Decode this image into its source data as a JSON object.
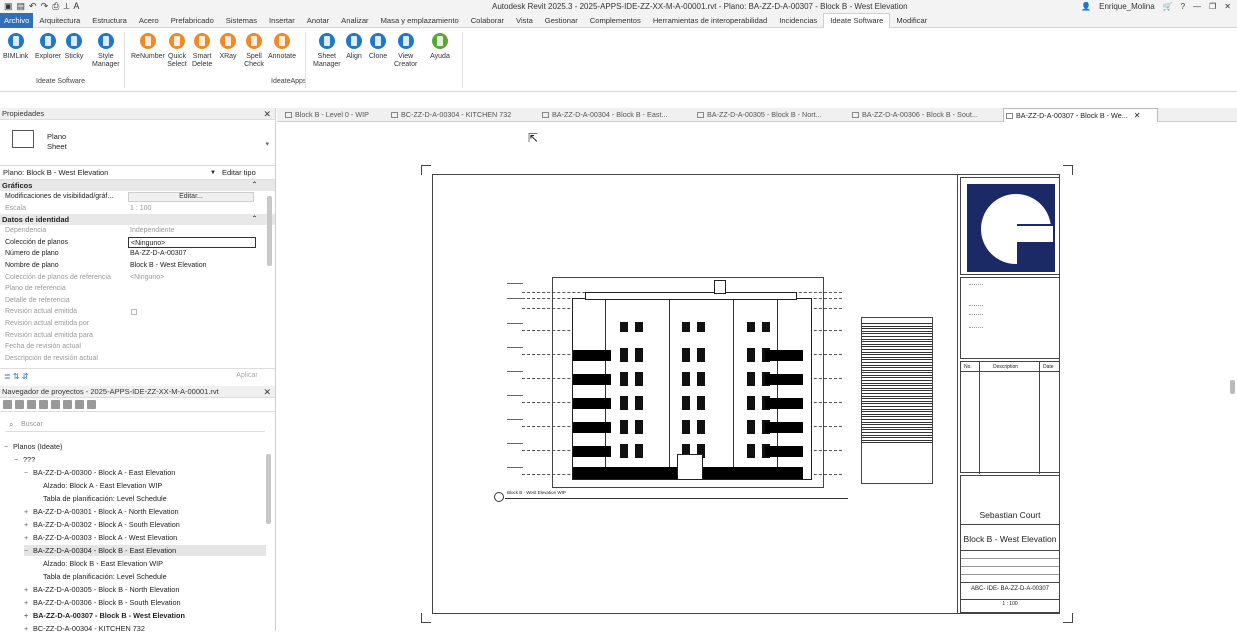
{
  "titlebar": {
    "title": "Autodesk Revit 2025.3 - 2025-APPS-IDE-ZZ-XX-M-A-00001.rvt - Plano: BA-ZZ-D-A-00307 - Block B - West Elevation",
    "user": "Enrique_Molina",
    "help": "?"
  },
  "menu": {
    "tabs": [
      "Archivo",
      "Arquitectura",
      "Estructura",
      "Acero",
      "Prefabricado",
      "Sistemas",
      "Insertar",
      "Anotar",
      "Analizar",
      "Masa y emplazamiento",
      "Colaborar",
      "Vista",
      "Gestionar",
      "Complementos",
      "Herramientas de interoperabilidad",
      "Incidencias",
      "Ideate Software",
      "Modificar"
    ]
  },
  "ribbon": {
    "buttons": [
      {
        "label": "BIMLink",
        "color": "#1f78c8"
      },
      {
        "label": "Explorer",
        "color": "#1f78c8"
      },
      {
        "label": "Sticky",
        "color": "#1f78c8"
      },
      {
        "label": "Style\nManager",
        "color": "#1f78c8"
      },
      {
        "label": "ReNumber",
        "color": "#f08a24"
      },
      {
        "label": "Quick\nSelect",
        "color": "#f08a24"
      },
      {
        "label": "Smart\nDelete",
        "color": "#f08a24"
      },
      {
        "label": "XRay",
        "color": "#f08a24"
      },
      {
        "label": "Spell\nCheck",
        "color": "#f08a24"
      },
      {
        "label": "Annotate",
        "color": "#f08a24"
      },
      {
        "label": "Sheet\nManager",
        "color": "#1f78c8"
      },
      {
        "label": "Align",
        "color": "#1f78c8"
      },
      {
        "label": "Clone",
        "color": "#1f78c8"
      },
      {
        "label": "View\nCreator",
        "color": "#1f78c8"
      },
      {
        "label": "Ayuda",
        "color": "#5aa832"
      }
    ],
    "groups": {
      "g1": "Ideate Software",
      "g2": "IdeateApps"
    }
  },
  "properties": {
    "header": "Propiedades",
    "type_name": "Plano",
    "type_sub": "Sheet",
    "selector": "Plano: Block B - West Elevation",
    "edit_type": "Editar tipo",
    "sections": {
      "graphics": "Gráficos",
      "identity": "Datos de identidad"
    },
    "rows": {
      "vis_label": "Modificaciones de visibilidad/gráf...",
      "vis_btn": "Editar...",
      "scale_label": "Escala",
      "scale_val": "1 : 100",
      "dep_label": "Dependencia",
      "dep_val": "Independiente",
      "coll_label": "Colección de planos",
      "coll_val": "<Ninguno>",
      "num_label": "Número de plano",
      "num_val": "BA-ZZ-D-A-00307",
      "name_label": "Nombre de plano",
      "name_val": "Block B - West Elevation",
      "refcoll_label": "Colección de planos de referencia",
      "refcoll_val": "<Ninguno>",
      "refplan_label": "Plano de referencia",
      "refdet_label": "Detalle de referencia",
      "rev_label": "Revisión actual emitida",
      "revby_label": "Revisión actual emitida por",
      "revfor_label": "Revisión actual emitida para",
      "revdate_label": "Fecha de revisión actual",
      "revdesc_label": "Descripción de revisión actual"
    },
    "apply": "Aplicar"
  },
  "browser": {
    "header": "Navegador de proyectos - 2025-APPS-IDE-ZZ-XX-M-A-00001.rvt",
    "search_placeholder": "Buscar",
    "nodes": [
      {
        "text": "Planos (Ideate)",
        "exp": "−",
        "indent": 0
      },
      {
        "text": "???",
        "exp": "−",
        "indent": 1
      },
      {
        "text": "BA-ZZ-D-A-00300 - Block A - East Elevation",
        "exp": "−",
        "indent": 2
      },
      {
        "text": "Alzado: Block A - East Elevation WIP",
        "exp": "",
        "indent": 3
      },
      {
        "text": "Tabla de planificación: Level Schedule",
        "exp": "",
        "indent": 3
      },
      {
        "text": "BA-ZZ-D-A-00301 - Block A - North Elevation",
        "exp": "+",
        "indent": 2
      },
      {
        "text": "BA-ZZ-D-A-00302 - Block A - South Elevation",
        "exp": "+",
        "indent": 2
      },
      {
        "text": "BA-ZZ-D-A-00303 - Block A - West Elevation",
        "exp": "+",
        "indent": 2
      },
      {
        "text": "BA-ZZ-D-A-00304 - Block B - East Elevation",
        "exp": "−",
        "indent": 2
      },
      {
        "text": "Alzado: Block B - East Elevation WIP",
        "exp": "",
        "indent": 3
      },
      {
        "text": "Tabla de planificación: Level Schedule",
        "exp": "",
        "indent": 3
      },
      {
        "text": "BA-ZZ-D-A-00305 - Block B - North Elevation",
        "exp": "+",
        "indent": 2
      },
      {
        "text": "BA-ZZ-D-A-00306 - Block B - South Elevation",
        "exp": "+",
        "indent": 2
      },
      {
        "text": "BA-ZZ-D-A-00307 - Block B - West Elevation",
        "exp": "+",
        "indent": 2
      },
      {
        "text": "BC-ZZ-D-A-00304 - KITCHEN 732",
        "exp": "+",
        "indent": 2
      }
    ]
  },
  "doctabs": [
    {
      "label": "Block B - Level 0 - WIP"
    },
    {
      "label": "BC-ZZ-D-A-00304 - KITCHEN 732"
    },
    {
      "label": "BA-ZZ-D-A-00304 - Block B - East..."
    },
    {
      "label": "BA-ZZ-D-A-00305 - Block B - Nort..."
    },
    {
      "label": "BA-ZZ-D-A-00306 - Block B - Sout..."
    },
    {
      "label": "BA-ZZ-D-A-00307 - Block B - We..."
    }
  ],
  "sheet": {
    "tb_table_headers": {
      "no": "No.",
      "desc": "Description",
      "date": "Date"
    },
    "project_name": "Sebastian Court",
    "sheet_name": "Block B - West Elevation",
    "sheet_number": "ABC- IDE- BA-ZZ-D-A-00307",
    "scale": "1 : 100",
    "view_title": "Block B - West Elevation WIP"
  }
}
